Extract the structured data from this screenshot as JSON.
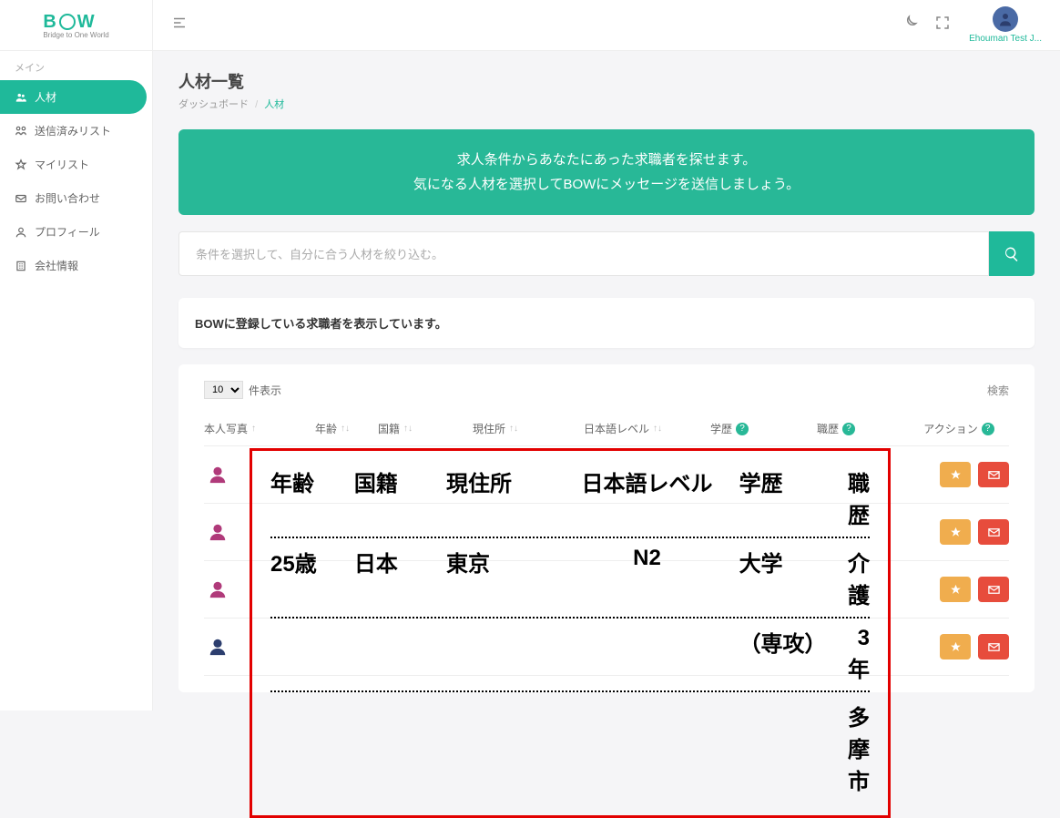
{
  "logo": {
    "text_left": "B",
    "text_right": "W",
    "subtitle": "Bridge to One World"
  },
  "sidebar": {
    "section": "メイン",
    "items": [
      {
        "label": "人材",
        "icon": "people-icon"
      },
      {
        "label": "送信済みリスト",
        "icon": "sent-icon"
      },
      {
        "label": "マイリスト",
        "icon": "star-icon"
      },
      {
        "label": "お問い合わせ",
        "icon": "mail-icon"
      },
      {
        "label": "プロフィール",
        "icon": "profile-icon"
      },
      {
        "label": "会社情報",
        "icon": "building-icon"
      }
    ]
  },
  "header": {
    "user_name": "Ehouman Test J..."
  },
  "page": {
    "title": "人材一覧",
    "breadcrumb_root": "ダッシュボード",
    "breadcrumb_current": "人材"
  },
  "banner": {
    "line1": "求人条件からあなたにあった求職者を探せます。",
    "line2": "気になる人材を選択してBOWにメッセージを送信しましょう。"
  },
  "filter": {
    "placeholder": "条件を選択して、自分に合う人材を絞り込む。"
  },
  "info_card": {
    "text": "BOWに登録している求職者を表示しています。"
  },
  "table": {
    "page_size_value": "10",
    "page_size_label": "件表示",
    "search_label": "検索",
    "columns": {
      "photo": "本人写真",
      "age": "年齢",
      "nationality": "国籍",
      "address": "現住所",
      "jp_level": "日本語レベル",
      "education": "学歴",
      "work": "職歴",
      "action": "アクション"
    }
  },
  "overlay": {
    "header": {
      "age": "年齢",
      "nat": "国籍",
      "addr": "現住所",
      "jp": "日本語レベル",
      "edu": "学歴",
      "work": "職歴"
    },
    "row1": {
      "age": "25歳",
      "nat": "日本",
      "addr": "東京",
      "jp": "N2",
      "edu": "大学",
      "work": "介護"
    },
    "row2": {
      "age": "",
      "nat": "",
      "addr": "",
      "jp": "",
      "edu": "（専攻）",
      "work": "3年"
    },
    "row3": {
      "age": "",
      "nat": "",
      "addr": "",
      "jp": "",
      "edu": "",
      "work": "多摩市"
    }
  }
}
